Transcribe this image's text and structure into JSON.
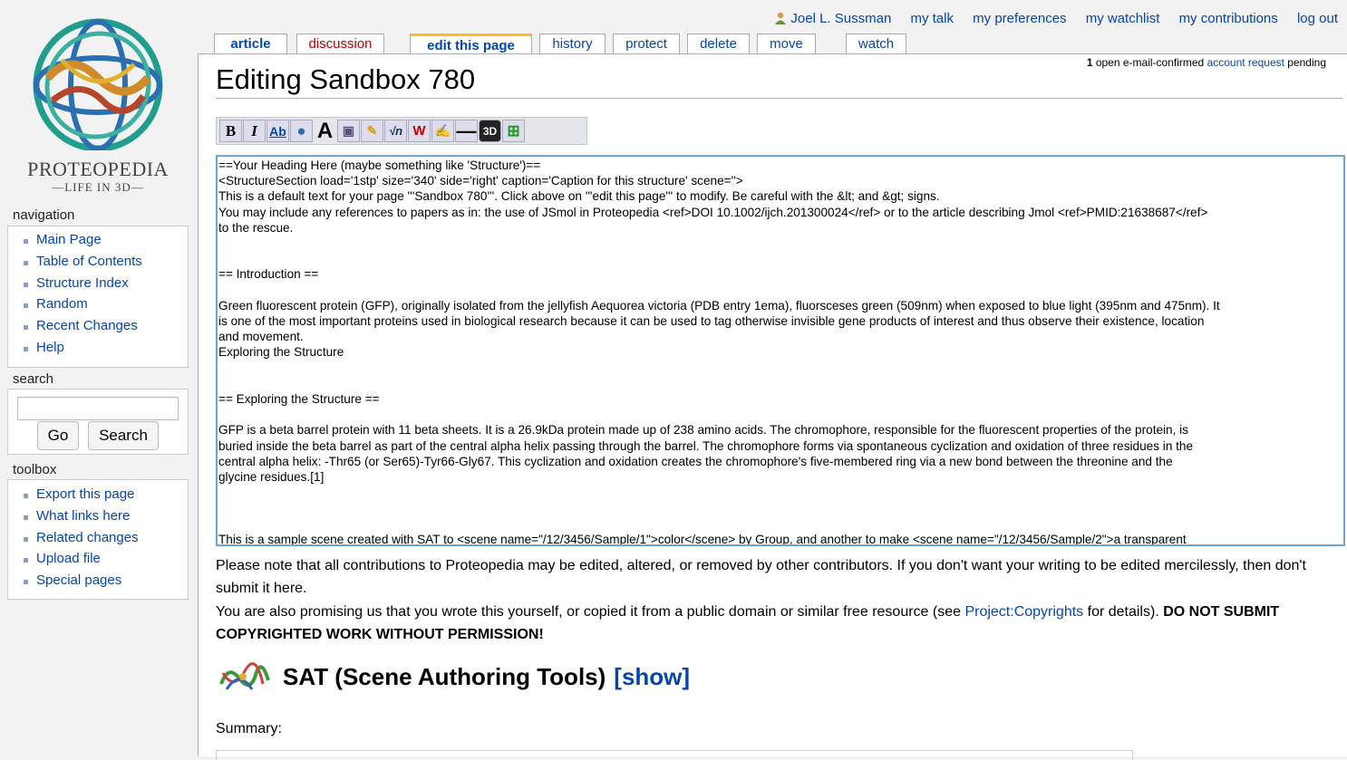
{
  "personal_tools": {
    "user": "Joel L. Sussman",
    "my_talk": "my talk",
    "my_preferences": "my preferences",
    "my_watchlist": "my watchlist",
    "my_contributions": "my contributions",
    "log_out": "log out"
  },
  "logo": {
    "line1": "PROTEOPEDIA",
    "line2": "LIFE IN 3D"
  },
  "tabs": {
    "article": "article",
    "discussion": "discussion",
    "edit": "edit this page",
    "history": "history",
    "protect": "protect",
    "delete": "delete",
    "move": "move",
    "watch": "watch"
  },
  "navigation": {
    "heading": "navigation",
    "items": [
      "Main Page",
      "Table of Contents",
      "Structure Index",
      "Random",
      "Recent Changes",
      "Help"
    ]
  },
  "search": {
    "heading": "search",
    "go": "Go",
    "search": "Search",
    "value": ""
  },
  "toolbox": {
    "heading": "toolbox",
    "items": [
      "Export this page",
      "What links here",
      "Related changes",
      "Upload file",
      "Special pages"
    ]
  },
  "notice": {
    "count": "1",
    "pre": " open e-mail-confirmed ",
    "link": "account request",
    "post": " pending"
  },
  "page_title": "Editing Sandbox 780",
  "toolbar": {
    "bold": "B",
    "italic": "I",
    "link": "Ab",
    "heading": "A",
    "math": "√n",
    "nowiki": "W",
    "hr": "—",
    "scene3d": "3D"
  },
  "editor_text": "==Your Heading Here (maybe something like 'Structure')==\n<StructureSection load='1stp' size='340' side='right' caption='Caption for this structure' scene=''>\nThis is a default text for your page '''Sandbox 780'''. Click above on '''edit this page''' to modify. Be careful with the &lt; and &gt; signs.\nYou may include any references to papers as in: the use of JSmol in Proteopedia <ref>DOI 10.1002/ijch.201300024</ref> or to the article describing Jmol <ref>PMID:21638687</ref>\nto the rescue.\n\n\n== Introduction ==\n\nGreen fluorescent protein (GFP), originally isolated from the jellyfish Aequorea victoria (PDB entry 1ema), fluorsceses green (509nm) when exposed to blue light (395nm and 475nm). It\nis one of the most important proteins used in biological research because it can be used to tag otherwise invisible gene products of interest and thus observe their existence, location\nand movement.\nExploring the Structure\n\n\n== Exploring the Structure ==\n\nGFP is a beta barrel protein with 11 beta sheets. It is a 26.9kDa protein made up of 238 amino acids. The chromophore, responsible for the fluorescent properties of the protein, is\nburied inside the beta barrel as part of the central alpha helix passing through the barrel. The chromophore forms via spontaneous cyclization and oxidation of three residues in the\ncentral alpha helix: -Thr65 (or Ser65)-Tyr66-Gly67. This cyclization and oxidation creates the chromophore's five-membered ring via a new bond between the threonine and the\nglycine residues.[1]\n\n\n\nThis is a sample scene created with SAT to <scene name=\"/12/3456/Sample/1\">color</scene> by Group, and another to make <scene name=\"/12/3456/Sample/2\">a transparent",
  "notes": {
    "p1": "Please note that all contributions to Proteopedia may be edited, altered, or removed by other contributors. If you don't want your writing to be edited mercilessly, then don't submit it here.",
    "p2_pre": "You are also promising us that you wrote this yourself, or copied it from a public domain or similar free resource (see ",
    "p2_link": "Project:Copyrights",
    "p2_mid": " for details). ",
    "p2_bold": "DO NOT SUBMIT COPYRIGHTED WORK WITHOUT PERMISSION!"
  },
  "sat": {
    "title": "SAT (Scene Authoring Tools)",
    "show": "[show]"
  },
  "summary_label": "Summary:"
}
